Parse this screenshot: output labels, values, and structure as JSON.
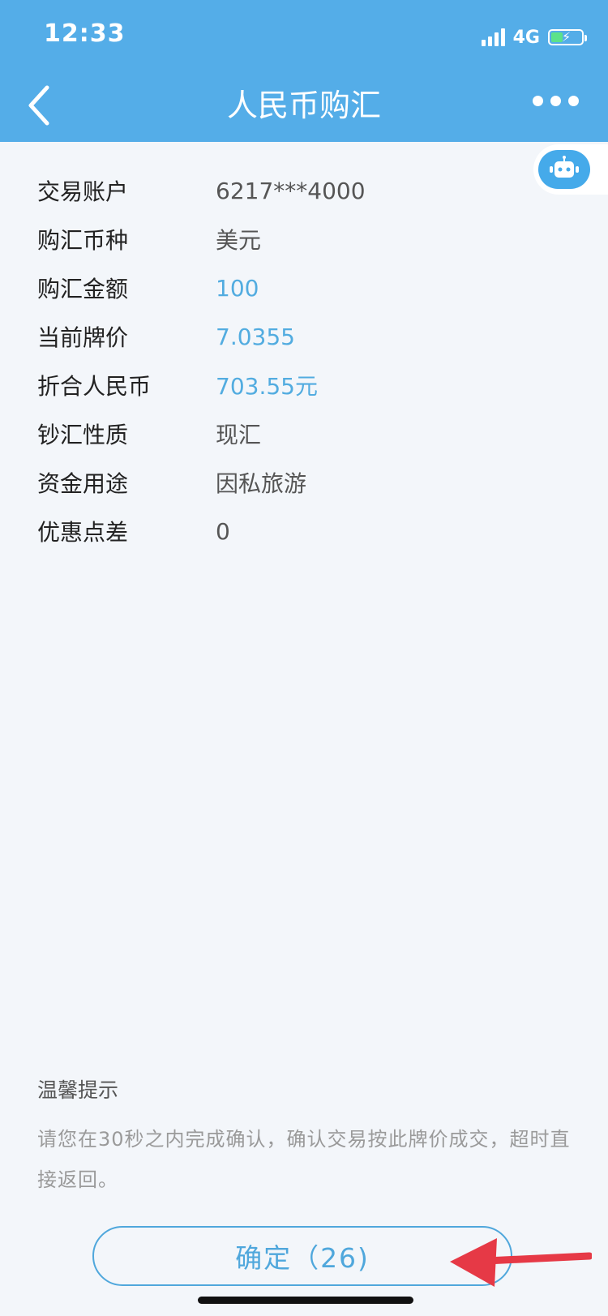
{
  "status_bar": {
    "time": "12:33",
    "network": "4G"
  },
  "header": {
    "title": "人民币购汇",
    "back_icon": "chevron-left-icon",
    "more_icon": "more-horizontal-icon",
    "background_color": "#54ade8"
  },
  "assistant": {
    "icon": "robot-icon"
  },
  "details": [
    {
      "label": "交易账户",
      "value": "6217***4000",
      "accent": false
    },
    {
      "label": "购汇币种",
      "value": "美元",
      "accent": false
    },
    {
      "label": "购汇金额",
      "value": "100",
      "accent": true
    },
    {
      "label": "当前牌价",
      "value": "7.0355",
      "accent": true
    },
    {
      "label": "折合人民币",
      "value": "703.55元",
      "accent": true
    },
    {
      "label": "钞汇性质",
      "value": "现汇",
      "accent": false
    },
    {
      "label": "资金用途",
      "value": "因私旅游",
      "accent": false
    },
    {
      "label": "优惠点差",
      "value": "0",
      "accent": false
    }
  ],
  "tips": {
    "title": "温馨提示",
    "text": "请您在30秒之内完成确认，确认交易按此牌价成交，超时直接返回。"
  },
  "confirm": {
    "label": "确定（26)"
  },
  "colors": {
    "accent": "#52ace0",
    "button_border": "#4fa7dc",
    "annotation_arrow": "#e63946"
  }
}
